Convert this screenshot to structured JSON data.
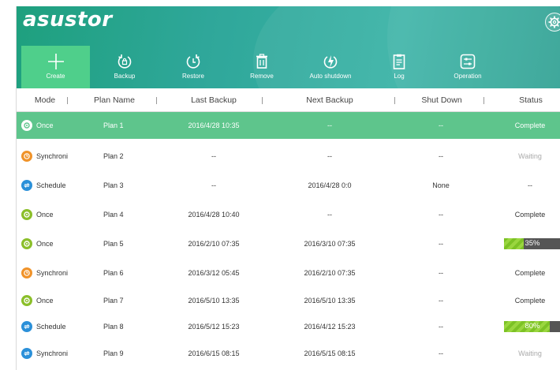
{
  "app": {
    "logo_text": "asustor",
    "settings_icon": "gear-icon"
  },
  "toolbar": [
    {
      "key": "create",
      "label": "Create",
      "icon": "plus-icon"
    },
    {
      "key": "backup",
      "label": "Backup",
      "icon": "backup-icon"
    },
    {
      "key": "restore",
      "label": "Restore",
      "icon": "restore-icon"
    },
    {
      "key": "remove",
      "label": "Remove",
      "icon": "trash-icon"
    },
    {
      "key": "auto_shutdown",
      "label": "Auto shutdown",
      "icon": "auto-shutdown-icon"
    },
    {
      "key": "log",
      "label": "Log",
      "icon": "log-icon"
    },
    {
      "key": "operation",
      "label": "Operation",
      "icon": "operation-icon"
    }
  ],
  "table": {
    "columns": [
      "Mode",
      "Plan Name",
      "Last Backup",
      "Next Backup",
      "Shut Down",
      "Status"
    ],
    "rows": [
      {
        "mode": "Once",
        "mode_icon": "once-icon",
        "plan": "Plan 1",
        "last": "2016/4/28 10:35",
        "next": "--",
        "shutdown": "--",
        "status": "Complete",
        "selected": true
      },
      {
        "mode": "Synchroni",
        "mode_icon": "synchronize-icon",
        "plan": "Plan 2",
        "last": "--",
        "next": "--",
        "shutdown": "--",
        "status": "Waiting"
      },
      {
        "mode": "Schedule",
        "mode_icon": "schedule-icon",
        "plan": "Plan 3",
        "last": "--",
        "next": "2016/4/28 0:0",
        "shutdown": "None",
        "status": "--"
      },
      {
        "mode": "Once",
        "mode_icon": "once-icon",
        "plan": "Plan 4",
        "last": "2016/4/28 10:40",
        "next": "--",
        "shutdown": "--",
        "status": "Complete"
      },
      {
        "mode": "Once",
        "mode_icon": "once-icon",
        "plan": "Plan 5",
        "last": "2016/2/10 07:35",
        "next": "2016/3/10 07:35",
        "shutdown": "--",
        "status": "35%",
        "progress": 0.35
      },
      {
        "mode": "Synchroni",
        "mode_icon": "synchronize-icon",
        "plan": "Plan 6",
        "last": "2016/3/12  05:45",
        "next": "2016/2/10 07:35",
        "shutdown": "--",
        "status": "Complete"
      },
      {
        "mode": "Once",
        "mode_icon": "once-icon",
        "plan": "Plan 7",
        "last": "2016/5/10 13:35",
        "next": "2016/5/10 13:35",
        "shutdown": "--",
        "status": "Complete"
      },
      {
        "mode": "Schedule",
        "mode_icon": "schedule-icon",
        "plan": "Plan 8",
        "last": "2016/5/12 15:23",
        "next": "2016/4/12 15:23",
        "shutdown": "--",
        "status": "80%",
        "progress": 0.8
      },
      {
        "mode": "Synchroni",
        "mode_icon": "schedule-icon",
        "plan": "Plan 9",
        "last": "2016/6/15  08:15",
        "next": "2016/5/15 08:15",
        "shutdown": "--",
        "status": "Waiting"
      }
    ]
  },
  "colors": {
    "header_start": "#1ea07e",
    "header_end": "#2a9f90",
    "create_active": "#4fcf8b",
    "selected_row": "#5ec58c",
    "once": "#8bbf2a",
    "synchronize": "#f0932a",
    "schedule": "#2b90d9",
    "progress_fill": "#7cc225",
    "progress_track": "#555555"
  }
}
